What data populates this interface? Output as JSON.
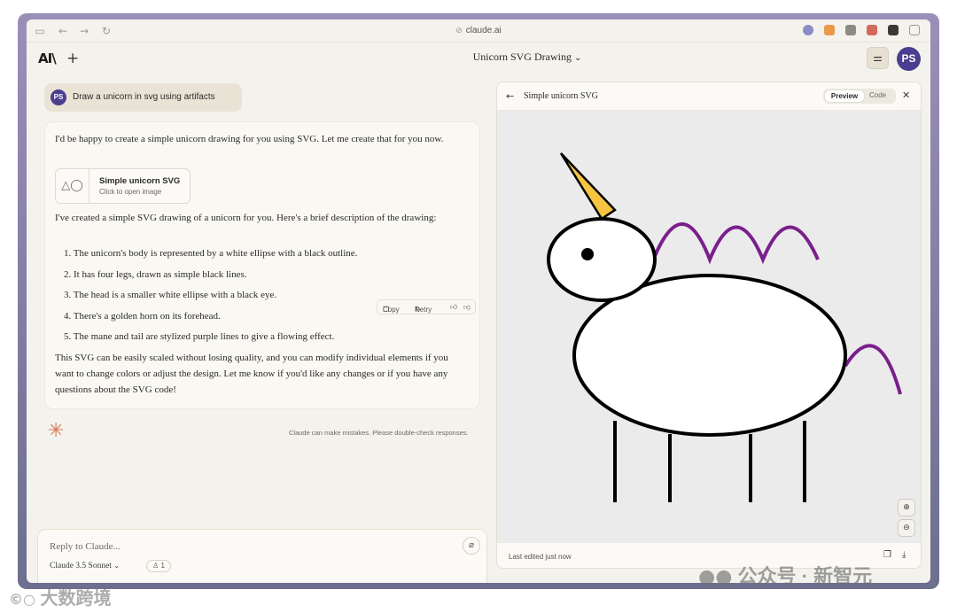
{
  "browser": {
    "url": "claude.ai",
    "back_icon": "arrow-left-icon",
    "forward_icon": "arrow-right-icon",
    "reload_icon": "reload-icon",
    "sidebar_icon": "sidebar-icon"
  },
  "header": {
    "logo": "AI\\",
    "new_chat": "+",
    "title": "Unicorn SVG Drawing",
    "title_chevron": "⌄",
    "settings_icon": "sliders-icon",
    "avatar": "PS"
  },
  "chat": {
    "user_avatar": "PS",
    "user_message": "Draw a unicorn in svg using artifacts",
    "intro": "I'd be happy to create a simple unicorn drawing for you using SVG. Let me create that for you now.",
    "artifact": {
      "title": "Simple unicorn SVG",
      "subtitle": "Click to open image",
      "icon": "shapes-icon"
    },
    "description": "I've created a simple SVG drawing of a unicorn for you. Here's a brief description of the drawing:",
    "list": [
      "1. The unicorn's body is represented by a white ellipse with a black outline.",
      "2. It has four legs, drawn as simple black lines.",
      "3. The head is a smaller white ellipse with a black eye.",
      "4. There's a golden horn on its forehead.",
      "5. The mane and tail are stylized purple lines to give a flowing effect."
    ],
    "outro": "This SVG can be easily scaled without losing quality, and you can modify individual elements if you want to change colors or adjust the design. Let me know if you'd like any changes or if you have any questions about the SVG code!",
    "actions": {
      "copy": "Copy",
      "retry": "Retry"
    },
    "disclaimer": "Claude can make mistakes. Please double-check responses."
  },
  "input": {
    "placeholder": "Reply to Claude...",
    "model": "Claude 3.5 Sonnet",
    "style_count": "1"
  },
  "panel": {
    "title": "Simple unicorn SVG",
    "tabs": [
      "Preview",
      "Code"
    ],
    "active_tab": "Preview",
    "footer": "Last edited just now",
    "colors": {
      "body_fill": "#ffffff",
      "outline": "#000000",
      "horn": "#f5c542",
      "mane_tail": "#7a1f8c"
    }
  },
  "watermarks": {
    "left": "大数跨境",
    "right": "公众号 · 新智元"
  }
}
